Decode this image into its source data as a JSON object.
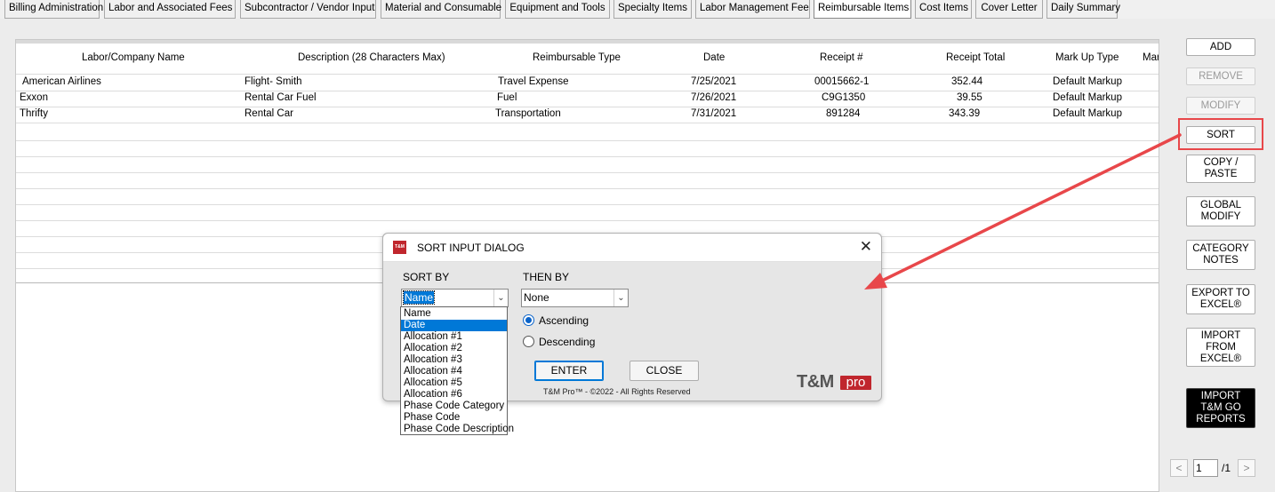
{
  "tabs": [
    {
      "label": "Billing Administration"
    },
    {
      "label": "Labor and Associated Fees"
    },
    {
      "label": "Subcontractor / Vendor Input"
    },
    {
      "label": "Material and Consumable"
    },
    {
      "label": "Equipment and Tools"
    },
    {
      "label": "Specialty Items"
    },
    {
      "label": "Labor Management Fee"
    },
    {
      "label": "Reimbursable Items"
    },
    {
      "label": "Cost Items"
    },
    {
      "label": "Cover Letter"
    },
    {
      "label": "Daily Summary"
    }
  ],
  "active_tab": "Reimbursable Items",
  "grid": {
    "headers": {
      "name": "Labor/Company Name",
      "description": "Description (28 Characters Max)",
      "type": "Reimbursable Type",
      "date": "Date",
      "receipt": "Receipt #",
      "total": "Receipt Total",
      "markup": "Mark Up Type",
      "more": "Mar"
    },
    "rows": [
      {
        "name": "American Airlines",
        "description": "Flight- Smith",
        "type": "Travel Expense",
        "date": "7/25/2021",
        "receipt": "00015662-1",
        "total": "352.44",
        "markup": "Default Markup"
      },
      {
        "name": "Exxon",
        "description": "Rental Car Fuel",
        "type": "Fuel",
        "date": "7/26/2021",
        "receipt": "C9G1350",
        "total": "39.55",
        "markup": "Default Markup"
      },
      {
        "name": "Thrifty",
        "description": "Rental Car",
        "type": "Transportation",
        "date": "7/31/2021",
        "receipt": "891284",
        "total": "343.39",
        "markup": "Default Markup"
      }
    ]
  },
  "side_buttons": {
    "add": "ADD",
    "remove": "REMOVE",
    "modify": "MODIFY",
    "sort": "SORT",
    "copy_paste_1": "COPY /",
    "copy_paste_2": "PASTE",
    "global_modify_1": "GLOBAL",
    "global_modify_2": "MODIFY",
    "category_notes_1": "CATEGORY",
    "category_notes_2": "NOTES",
    "export_1": "EXPORT TO",
    "export_2": "EXCEL®",
    "import_1": "IMPORT",
    "import_2": "FROM",
    "import_3": "EXCEL®",
    "import_go_1": "IMPORT",
    "import_go_2": "T&M GO",
    "import_go_3": "REPORTS"
  },
  "pager": {
    "prev": "<",
    "next": ">",
    "current": "1",
    "total": "/1"
  },
  "dialog": {
    "logo": "T&M",
    "title": "SORT INPUT DIALOG",
    "close": "✕",
    "sort_by_label": "SORT BY",
    "sort_by_value": "Name",
    "then_by_label": "THEN BY",
    "then_by_value": "None",
    "dropdown_options": [
      "Name",
      "Date",
      "Allocation #1",
      "Allocation #2",
      "Allocation #3",
      "Allocation #4",
      "Allocation #5",
      "Allocation #6",
      "Phase Code Category",
      "Phase Code",
      "Phase Code Description"
    ],
    "dropdown_highlighted": "Date",
    "ascending_label": "Ascending",
    "descending_label": "Descending",
    "order_selected": "Ascending",
    "enter_label": "ENTER",
    "close_label": "CLOSE",
    "footer": "T&M Pro™ - ©2022 - All Rights Reserved",
    "brand_tm": "T&M",
    "brand_pro": "pro"
  },
  "colors": {
    "annotation": "#e8474a",
    "selection": "#0078d7",
    "brand_red": "#c0262d"
  }
}
